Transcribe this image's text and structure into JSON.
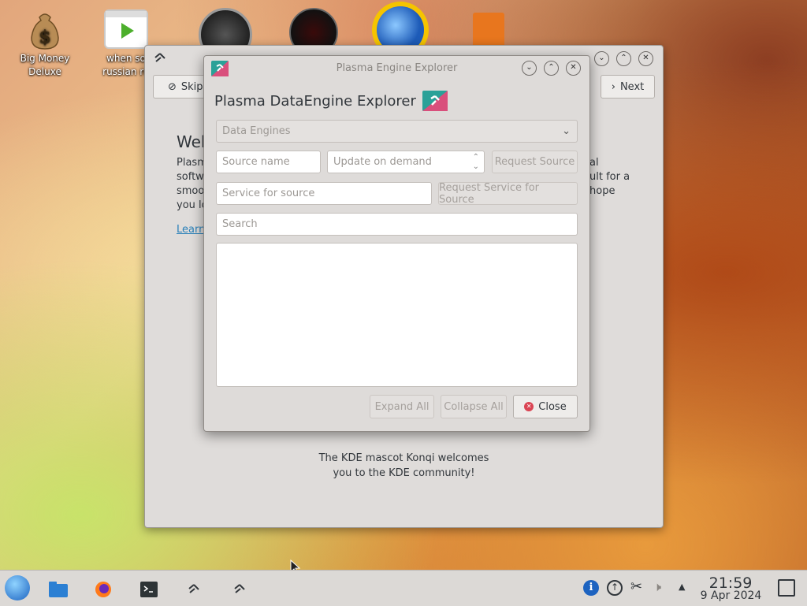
{
  "desktop": {
    "icons": [
      {
        "label": "Big Money Deluxe"
      },
      {
        "label": "when so russian ru"
      }
    ]
  },
  "welcome_window": {
    "skip_label": "Skip",
    "next_label": "Next",
    "heading": "Welc",
    "para_left": [
      "Plasm",
      "softw",
      "smoo",
      "you lo"
    ],
    "para_right": [
      "al",
      "ult for a",
      "hope"
    ],
    "learn_link": "Learn",
    "mascot_line1": "The KDE mascot Konqi welcomes",
    "mascot_line2": "you to the KDE community!"
  },
  "dialog": {
    "window_title": "Plasma Engine Explorer",
    "heading": "Plasma DataEngine Explorer",
    "engine_select": "Data Engines",
    "source_name_placeholder": "Source name",
    "update_placeholder": "Update on demand",
    "request_source_label": "Request Source",
    "service_placeholder": "Service for source",
    "request_service_label": "Request Service for Source",
    "search_placeholder": "Search",
    "expand_all_label": "Expand All",
    "collapse_all_label": "Collapse All",
    "close_label": "Close"
  },
  "taskbar": {
    "clock_time": "21:59",
    "clock_date": "9 Apr 2024"
  },
  "colors": {
    "window_bg": "#dedbd9",
    "link": "#2980b9",
    "close_red": "#da4453"
  }
}
